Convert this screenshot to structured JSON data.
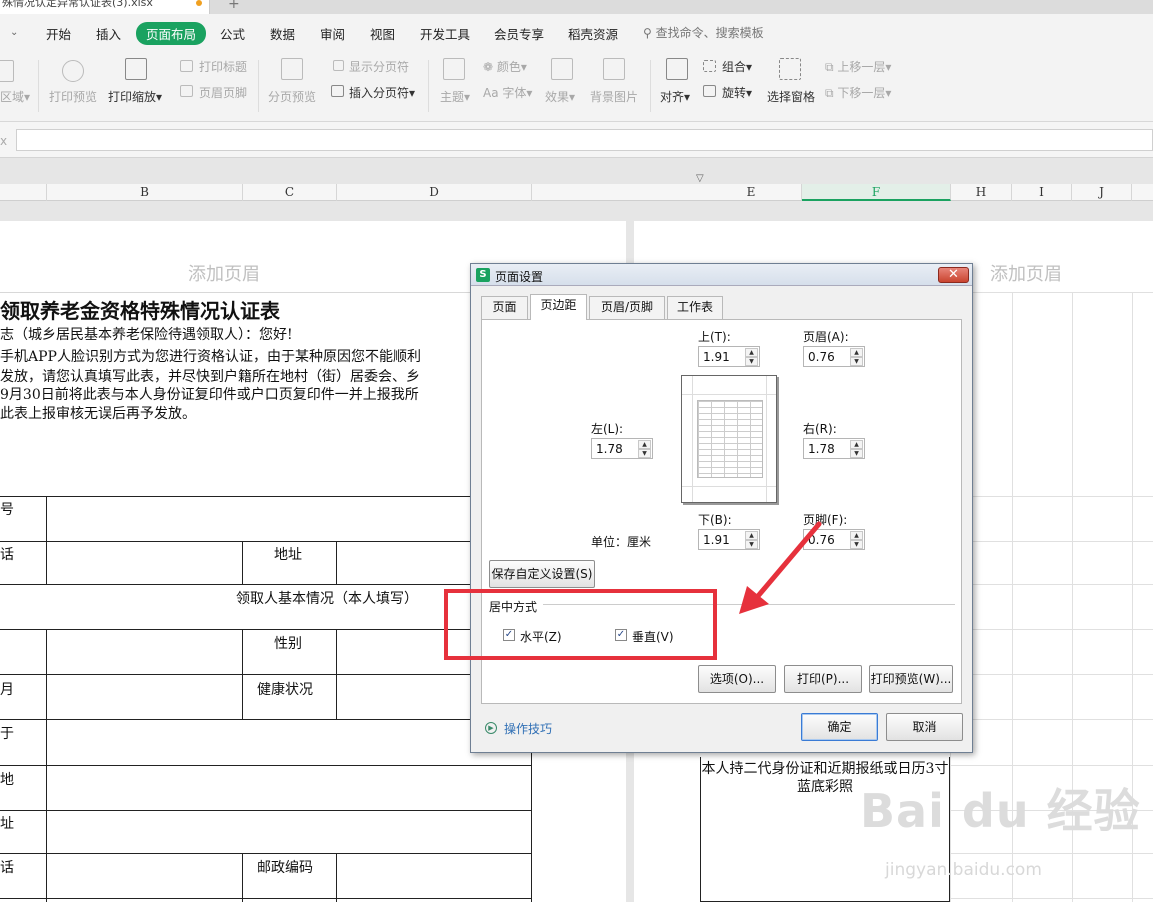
{
  "window": {
    "file_tab": "殊情况认定异常认证表(3).xlsx",
    "new_tab": "+"
  },
  "menu": {
    "items": [
      "开始",
      "插入",
      "页面布局",
      "公式",
      "数据",
      "审阅",
      "视图",
      "开发工具",
      "会员专享",
      "稻壳资源"
    ],
    "active": "页面布局",
    "search": "查找命令、搜索模板"
  },
  "ribbon": {
    "area_label": "区域",
    "print_preview": "打印预览",
    "print_scale": "打印缩放",
    "print_title": "打印标题",
    "header_footer": "页眉页脚",
    "page_break_preview": "分页预览",
    "show_page_break": "显示分页符",
    "insert_page_break": "插入分页符",
    "theme": "主题",
    "color": "颜色",
    "font": "字体",
    "effect": "效果",
    "background": "背景图片",
    "align": "对齐",
    "group": "组合",
    "rotate": "旋转",
    "select_pane": "选择窗格",
    "bring_forward": "上移一层",
    "send_backward": "下移一层"
  },
  "formula_bar": {
    "fx": "x"
  },
  "columns": [
    "B",
    "C",
    "D",
    "E",
    "F",
    "H",
    "I",
    "J"
  ],
  "selected_column": "F",
  "sheet": {
    "header_placeholder": "添加页眉",
    "title": "领取养老金资格特殊情况认证表",
    "lines": [
      "志（城乡居民基本养老保险待遇领取人）：您好!",
      "手机APP人脸识别方式为您进行资格认证，由于某种原因您不能顺利",
      "发放，请您认真填写此表，并尽快到户籍所在地村（街）居委会、乡",
      "9月30日前将此表与本人身份证复印件或户口页复印件一并上报我所",
      "此表上报审核无误后再予发放。"
    ],
    "cells": {
      "c1": "号",
      "c2": "话",
      "address": "地址",
      "section": "领取人基本情况（本人填写）",
      "gender": "性别",
      "c3": "月",
      "health": "健康状况",
      "c4": "于",
      "c5": "地",
      "c6": "址",
      "c7": "话",
      "postcode": "邮政编码"
    },
    "photo_text": "本人持二代身份证和近期报纸或日历3寸\n蓝底彩照",
    "watermark": "Bai du 经验",
    "watermark_url": "jingyan.baidu.com"
  },
  "dialog": {
    "title": "页面设置",
    "tabs": [
      "页面",
      "页边距",
      "页眉/页脚",
      "工作表"
    ],
    "active_tab": "页边距",
    "fields": {
      "top": {
        "label": "上(T):",
        "value": "1.91"
      },
      "header": {
        "label": "页眉(A):",
        "value": "0.76"
      },
      "left": {
        "label": "左(L):",
        "value": "1.78"
      },
      "right": {
        "label": "右(R):",
        "value": "1.78"
      },
      "bottom": {
        "label": "下(B):",
        "value": "1.91"
      },
      "footer": {
        "label": "页脚(F):",
        "value": "0.76"
      }
    },
    "unit": "单位：厘米",
    "save_custom": "保存自定义设置(S)",
    "center_group": "居中方式",
    "horizontal": {
      "label": "水平(Z)",
      "checked": true
    },
    "vertical": {
      "label": "垂直(V)",
      "checked": true
    },
    "options_btn": "选项(O)...",
    "print_btn": "打印(P)...",
    "print_preview_btn": "打印预览(W)...",
    "tips": "操作技巧",
    "ok": "确定",
    "cancel": "取消"
  },
  "colors": {
    "accent": "#1aa260",
    "highlight": "#e6313c"
  }
}
